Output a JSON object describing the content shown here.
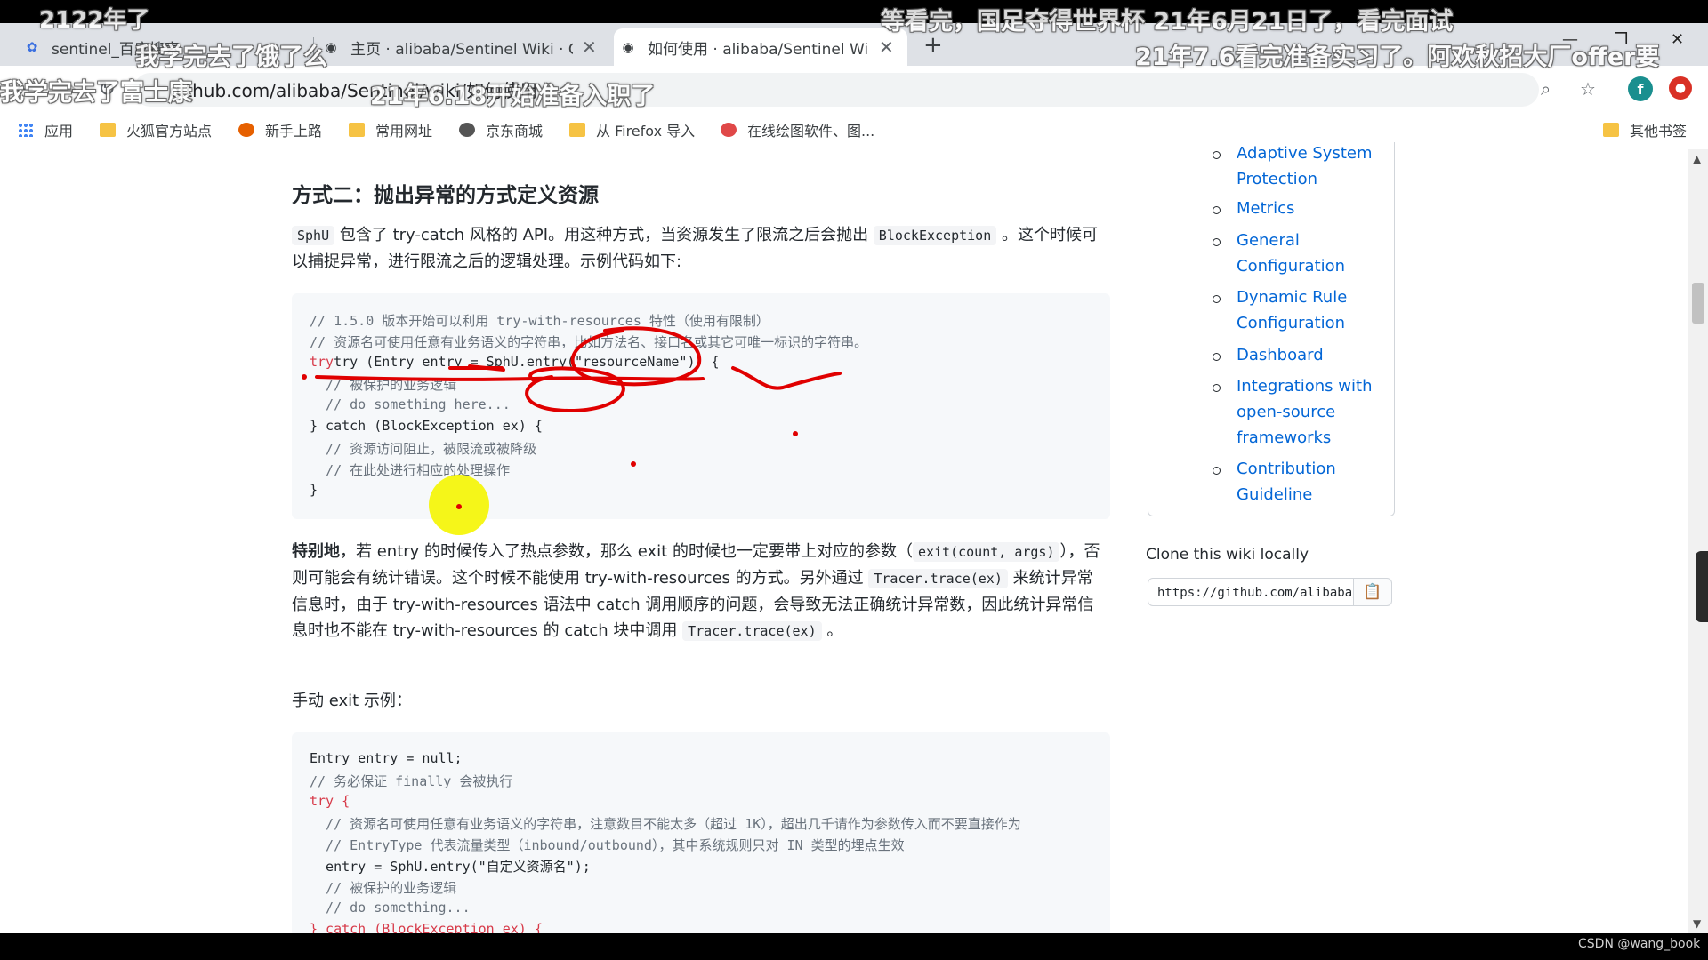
{
  "browser": {
    "tabs": [
      {
        "title": "sentinel_百度搜索",
        "active": false
      },
      {
        "title": "主页 · alibaba/Sentinel Wiki · G",
        "active": false
      },
      {
        "title": "如何使用 · alibaba/Sentinel Wi",
        "active": true
      }
    ],
    "new_tab": "+",
    "url_visible": "github.com/alibaba/Sentinel/wiki/如何使用",
    "profile_initial": "f"
  },
  "bookmarks": [
    {
      "label": "应用",
      "icon": "apps-grid-icon"
    },
    {
      "label": "火狐官方站点",
      "icon": "folder-icon"
    },
    {
      "label": "新手上路",
      "icon": "firefox-icon"
    },
    {
      "label": "常用网址",
      "icon": "folder-icon"
    },
    {
      "label": "京东商城",
      "icon": "globe-icon"
    },
    {
      "label": "从 Firefox 导入",
      "icon": "folder-icon"
    },
    {
      "label": "在线绘图软件、图...",
      "icon": "draw-icon"
    },
    {
      "label": "其他书签",
      "icon": "folder-icon"
    }
  ],
  "article": {
    "heading": "方式二：抛出异常的方式定义资源",
    "intro": {
      "code1": "SphU",
      "text1": " 包含了 try-catch 风格的 API。用这种方式，当资源发生了限流之后会抛出 ",
      "code2": "BlockException",
      "text2": " 。这个时候可以捕捉异常，进行限流之后的逻辑处理。示例代码如下:"
    },
    "code1_lines": [
      "// 1.5.0 版本开始可以利用 try-with-resources 特性（使用有限制）",
      "// 资源名可使用任意有业务语义的字符串，比如方法名、接口名或其它可唯一标识的字符串。",
      "try (Entry entry = SphU.entry(\"resourceName\")) {",
      "  // 被保护的业务逻辑",
      "  // do something here...",
      "} catch (BlockException ex) {",
      "  // 资源访问阻止，被限流或被降级",
      "  // 在此处进行相应的处理操作",
      "}"
    ],
    "special": {
      "bold": "特别地",
      "t1": "，若 entry 的时候传入了热点参数，那么 exit 的时候也一定要带上对应的参数（",
      "c1": "exit(count, args)",
      "t2": "），否则可能会有统计错误。这个时候不能使用 try-with-resources 的方式。另外通过 ",
      "c2": "Tracer.trace(ex)",
      "t3": " 来统计异常信息时，由于 try-with-resources 语法中 catch 调用顺序的问题，会导致无法正确统计异常数，因此统计异常信息时也不能在 try-with-resources 的 catch 块中调用 ",
      "c3": "Tracer.trace(ex)",
      "t4": " 。"
    },
    "manual_exit_label": "手动 exit 示例：",
    "code2_lines": [
      "Entry entry = null;",
      "// 务必保证 finally 会被执行",
      "try {",
      "  // 资源名可使用任意有业务语义的字符串，注意数目不能太多（超过 1K），超出几千请作为参数传入而不要直接作为",
      "  // EntryType 代表流量类型（inbound/outbound），其中系统规则只对 IN 类型的埋点生效",
      "  entry = SphU.entry(\"自定义资源名\");",
      "  // 被保护的业务逻辑",
      "  // do something...",
      "} catch (BlockException ex) {"
    ]
  },
  "sidebar": {
    "items": [
      "Adaptive System Protection",
      "Metrics",
      "General Configuration",
      "Dynamic Rule Configuration",
      "Dashboard",
      "Integrations with open-source frameworks",
      "Contribution Guideline"
    ],
    "clone_title": "Clone this wiki locally",
    "clone_url": "https://github.com/alibaba/Sentinel.wiki.git"
  },
  "danmaku": [
    "2122年了",
    "我学完去了饿了么",
    "我学完去了富士康",
    "21年6.18开始准备入职了",
    "等看完，国足夺得世界杯 21年6月21日了，看完面试",
    "21年7.6看完准备实习了。阿欢秋招大厂offer要"
  ],
  "watermark": "CSDN @wang_book",
  "annotation_color": "#e00000",
  "cursor_highlight_color": "#f5f500"
}
